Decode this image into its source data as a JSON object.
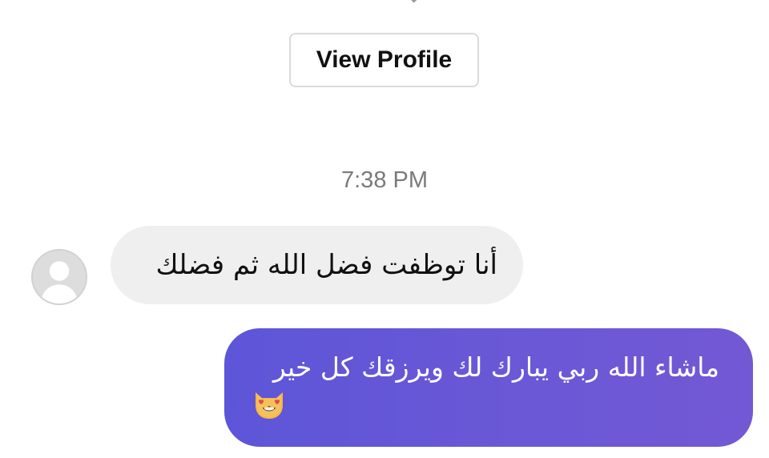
{
  "header": {
    "view_profile_label": "View Profile"
  },
  "conversation": {
    "timestamp": "7:38 PM",
    "messages": [
      {
        "direction": "incoming",
        "text": "أنا توظفت فضل الله ثم فضلك",
        "avatar_icon": "default-avatar-icon"
      },
      {
        "direction": "outgoing",
        "text": "ماشاء الله ربي يبارك لك ويرزقك كل خير",
        "emoji": "heart-eyes-cat-emoji"
      }
    ]
  },
  "colors": {
    "outgoing_bubble": "#6459d7",
    "incoming_bubble": "#efefef",
    "button_border": "#dbdbdb",
    "timestamp_text": "#7a7a7a"
  }
}
